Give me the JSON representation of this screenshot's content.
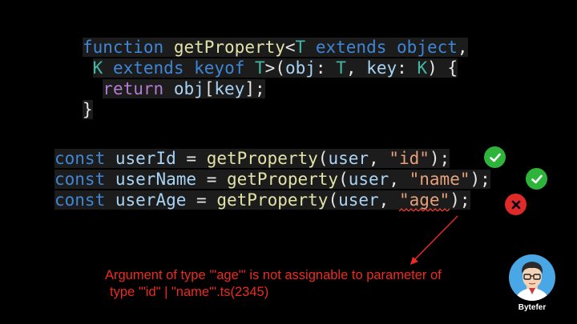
{
  "snippet1": {
    "line1": {
      "kw": "function",
      "fn": "getProperty",
      "p1": "<",
      "t": "T",
      "kw2": "extends",
      "obj": "object",
      "p2": ","
    },
    "line2": {
      "k": "K",
      "kw2": "extends",
      "kw3": "keyof",
      "t": "T",
      "p1": ">(",
      "obj": "obj",
      "p2": ":",
      "t2": "T",
      "p3": ",",
      "key": "key",
      "p4": ":",
      "k2": "K",
      "p5": ") {"
    },
    "line3": {
      "kw": "return",
      "obj": "obj",
      "p1": "[",
      "key": "key",
      "p2": "];"
    },
    "line4": {
      "p1": "}"
    }
  },
  "snippet2": {
    "lines": [
      {
        "kw": "const",
        "name": "userId",
        "eq": "=",
        "fn": "getProperty",
        "open": "(",
        "arg": "user",
        "comma": ",",
        "str": "\"id\"",
        "close": ");"
      },
      {
        "kw": "const",
        "name": "userName",
        "eq": "=",
        "fn": "getProperty",
        "open": "(",
        "arg": "user",
        "comma": ",",
        "str": "\"name\"",
        "close": ");"
      },
      {
        "kw": "const",
        "name": "userAge",
        "eq": "=",
        "fn": "getProperty",
        "open": "(",
        "arg": "user",
        "comma": ",",
        "str": "\"age\"",
        "close": ");"
      }
    ]
  },
  "status_icons": [
    "check-icon",
    "check-icon",
    "cross-icon"
  ],
  "error": {
    "line1": "Argument of type '\"age\"' is not assignable to parameter of",
    "line2": "type '\"id\" | \"name\"'.ts(2345)"
  },
  "brand": {
    "name": "Bytefer",
    "avatar_icon": "avatar-icon"
  },
  "colors": {
    "keyword": "#3f86d6",
    "function": "#e3e3a8",
    "type": "#42b8a4",
    "variable": "#a9d4f5",
    "string": "#e7a07b",
    "error": "#ec2b21",
    "ok": "#2fb43b"
  }
}
